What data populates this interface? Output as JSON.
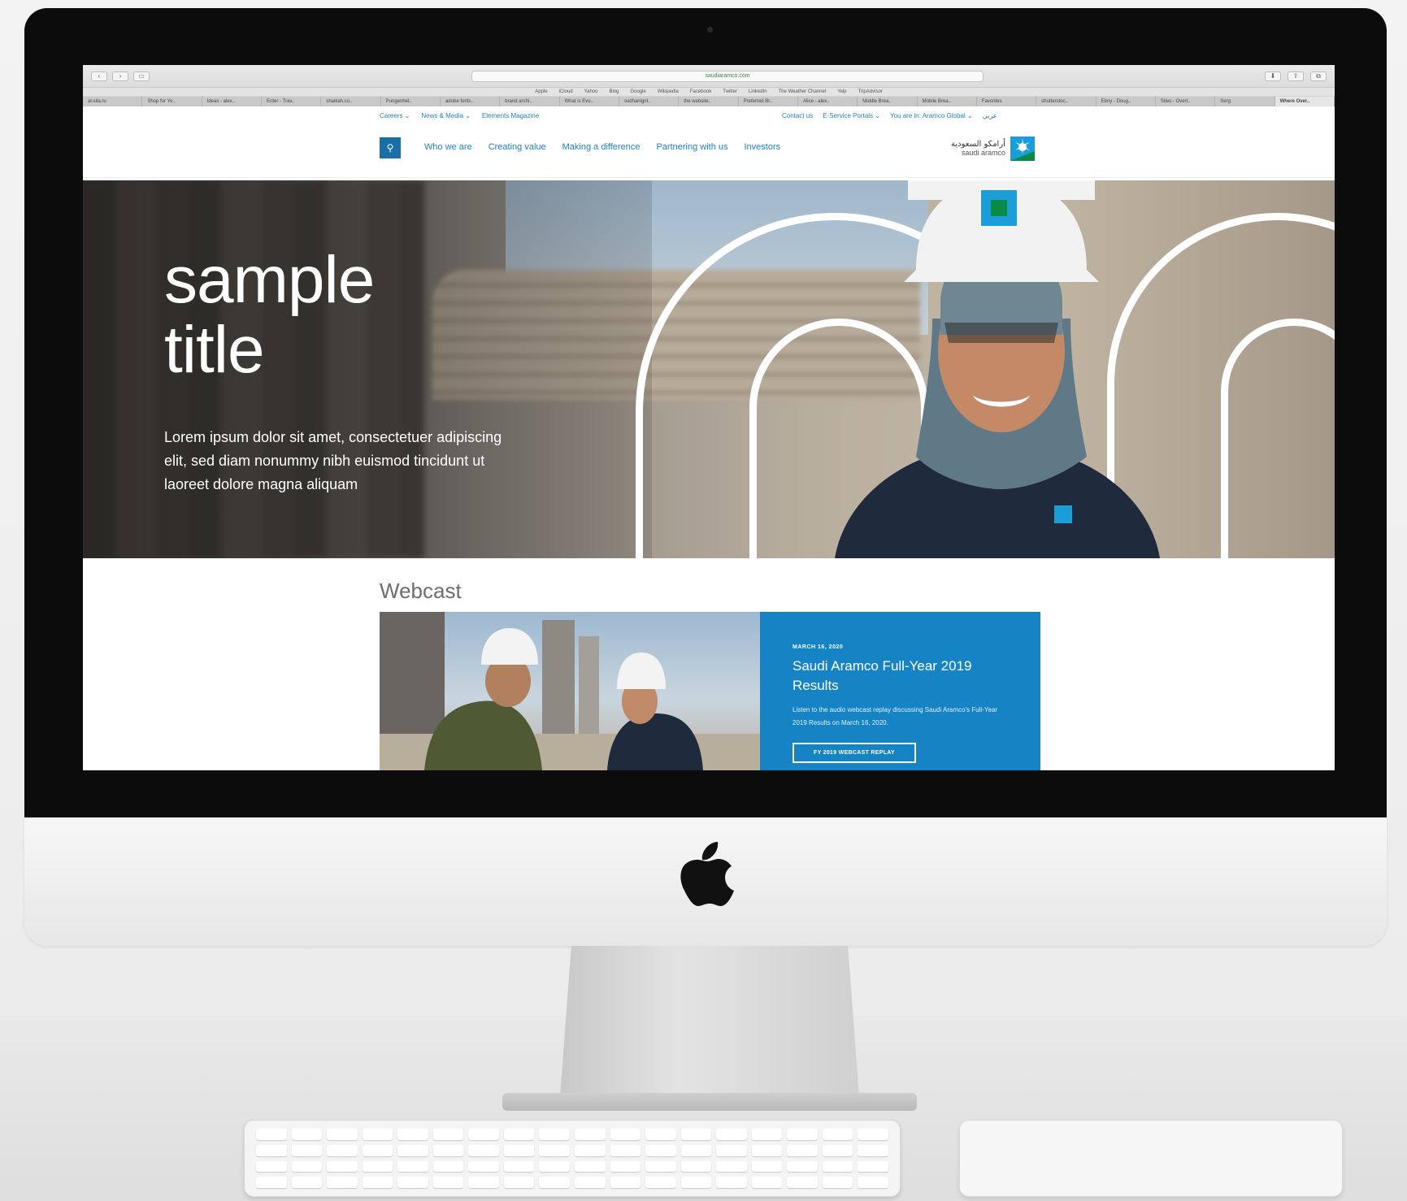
{
  "browser": {
    "url": "saudiaramco.com",
    "favorites": [
      "Apple",
      "iCloud",
      "Yahoo",
      "Bing",
      "Google",
      "Wikipedia",
      "Facebook",
      "Twitter",
      "LinkedIn",
      "The Weather Channel",
      "Yelp",
      "TripAdvisor"
    ],
    "tabs": [
      "al-sila.ru",
      "Shop for Yo..",
      "Ideas - alex..",
      "Enter - Trav..",
      "shaikah.co..",
      "Pungenhel..",
      "adobe fonts..",
      "brand archi..",
      "What is Evo..",
      "sudhanignt..",
      "the website..",
      "Preferred Br..",
      "Alice - alex..",
      "Middle Brea..",
      "Mobile Brea..",
      "Favorites",
      "shutterstoc..",
      "Ebny - Doug..",
      "Sites - Overt..",
      "Serg",
      "Where Over.."
    ]
  },
  "utility": {
    "left": [
      "Careers ⌄",
      "News & Media ⌄",
      "Elements Magazine"
    ],
    "right": [
      "Contact us",
      "E-Service Portals ⌄",
      "You are in: Aramco Global ⌄",
      "عربي"
    ]
  },
  "nav": {
    "items": [
      "Who we are",
      "Creating value",
      "Making a difference",
      "Partnering with us",
      "Investors"
    ],
    "logo_ar": "أرامكو السعودية",
    "logo_en": "saudi aramco"
  },
  "hero": {
    "title_line1": "sample",
    "title_line2": "title",
    "subtitle": "Lorem ipsum dolor sit amet, consectetuer adipiscing elit, sed diam nonummy nibh euismod tincidunt ut laoreet dolore magna aliquam"
  },
  "webcast": {
    "heading": "Webcast",
    "date": "MARCH 16, 2020",
    "title": "Saudi Aramco Full-Year 2019 Results",
    "description": "Listen to the audio webcast replay discussing Saudi Aramco's Full-Year 2019 Results on March 16, 2020.",
    "button": "FY 2019 WEBCAST REPLAY"
  },
  "colors": {
    "accent": "#1583c4",
    "nav_link": "#1f82c0",
    "search_button": "#1a6fa8"
  }
}
